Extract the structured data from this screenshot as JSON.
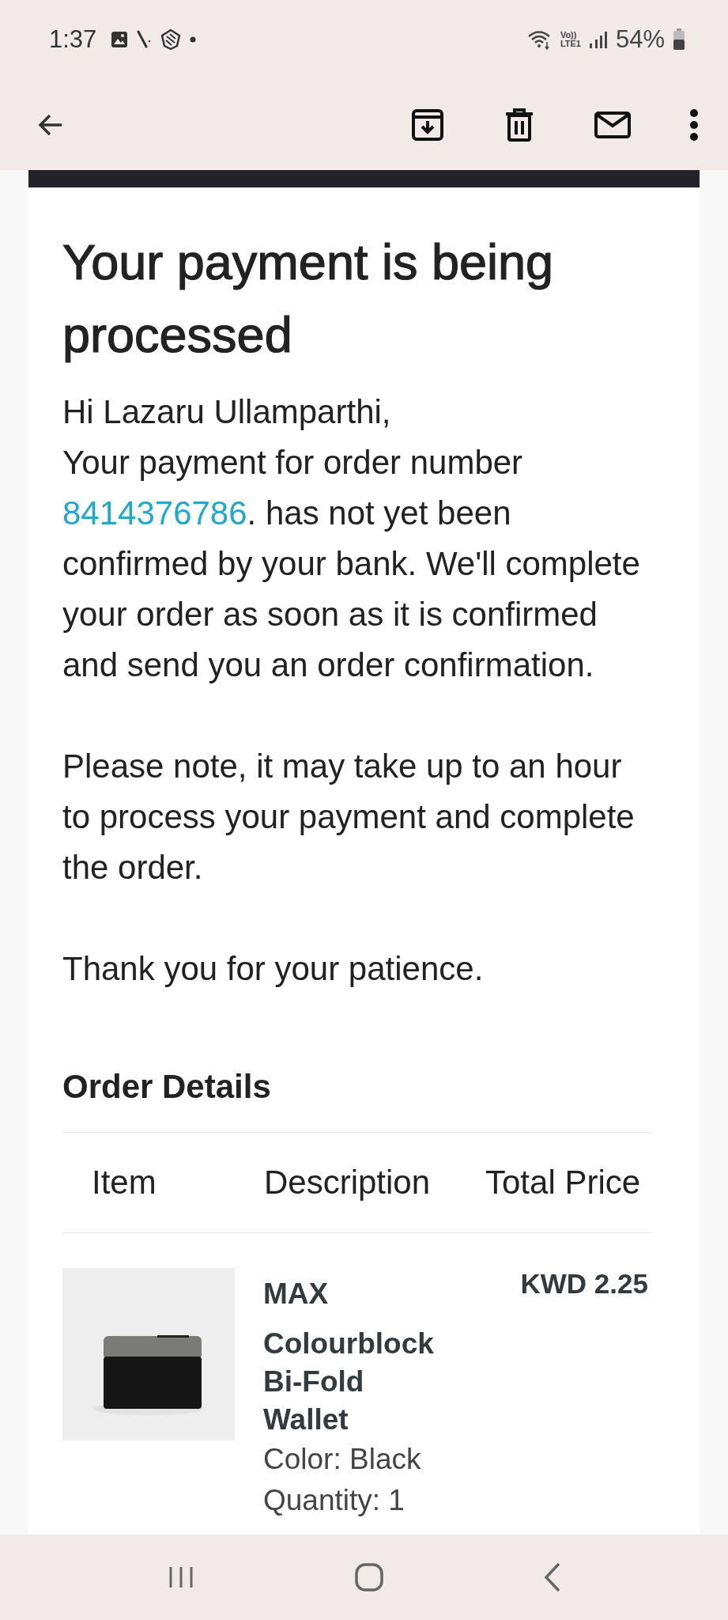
{
  "status_bar": {
    "time": "1:37",
    "network_label_top": "Vo))",
    "network_label_bottom": "LTE1",
    "battery": "54%"
  },
  "email": {
    "title": "Your payment is being processed",
    "greeting": "Hi Lazaru Ullamparthi,",
    "message_before": "Your payment for order number",
    "order_link": "8414376786",
    "message_after": ". has not yet been confirmed by your bank. We'll complete your order as soon as it is confirmed and send you an order confirmation.",
    "note": "Please note, it may take up to an hour to process your payment and complete the order.",
    "thanks": "Thank you for your patience.",
    "order_details": {
      "heading": "Order Details",
      "columns": [
        "Item",
        "Description",
        "Total Price"
      ],
      "rows": [
        {
          "brand": "MAX",
          "name": "Colourblock Bi-Fold Wallet",
          "color_label": "Color: Black",
          "quantity": "Quantity: 1",
          "price": "KWD 2.25"
        }
      ]
    }
  }
}
